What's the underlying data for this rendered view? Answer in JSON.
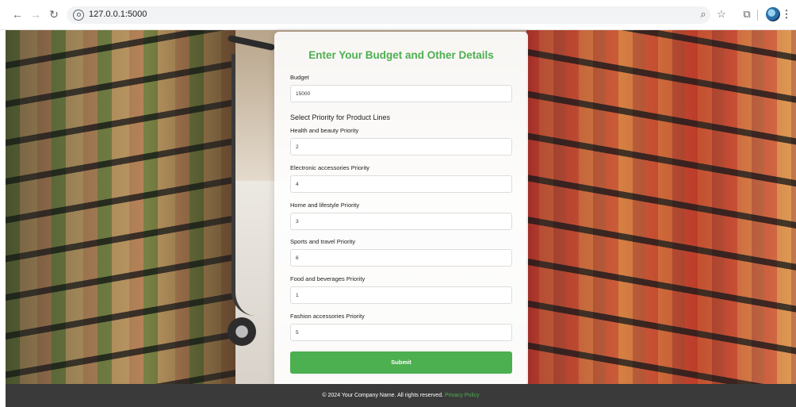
{
  "browser": {
    "url": "127.0.0.1:5000"
  },
  "form": {
    "title": "Enter Your Budget and Other Details",
    "budget": {
      "label": "Budget",
      "value": "15000"
    },
    "section_title": "Select Priority for Product Lines",
    "priorities": [
      {
        "label": "Health and beauty Priority",
        "value": "2"
      },
      {
        "label": "Electronic accessories Priority",
        "value": "4"
      },
      {
        "label": "Home and lifestyle Priority",
        "value": "3"
      },
      {
        "label": "Sports and travel Priority",
        "value": "6"
      },
      {
        "label": "Food and beverages Priority",
        "value": "1"
      },
      {
        "label": "Fashion accessories Priority",
        "value": "5"
      }
    ],
    "submit_label": "Submit"
  },
  "footer": {
    "text": "© 2024 Your Company Name. All rights reserved.",
    "link_label": "Privacy Policy"
  },
  "colors": {
    "accent": "#4caf50",
    "footer_bg": "#3a3a3a"
  }
}
